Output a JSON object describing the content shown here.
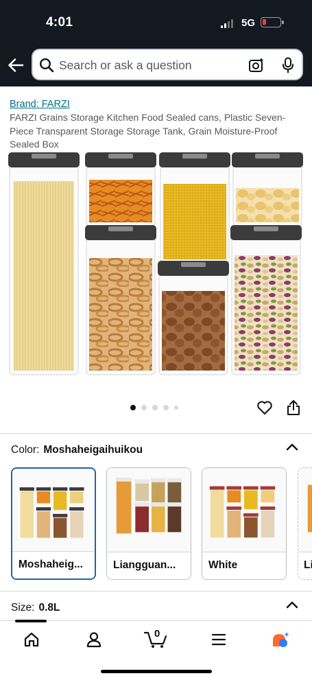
{
  "status": {
    "time": "4:01",
    "network": "5G"
  },
  "search": {
    "placeholder": "Search or ask a question"
  },
  "product": {
    "brand": "Brand: FARZI",
    "title": "FARZI Grains Storage Kitchen Food Sealed cans, Plastic Seven-Piece Transparent Storage Storage Tank, Grain Moisture-Proof Sealed Box",
    "image_count": 5,
    "image_index": 1
  },
  "color": {
    "label": "Color:",
    "selected": "Moshaheigaihuikou",
    "options": [
      {
        "label": "Moshaheig...",
        "selected": true
      },
      {
        "label": "Liangguan...",
        "selected": false
      },
      {
        "label": "White",
        "selected": false
      },
      {
        "label": "Li",
        "selected": false
      }
    ]
  },
  "size": {
    "label": "Size:",
    "selected": "0.8L"
  },
  "nav": {
    "cart_count": "0",
    "items": [
      "home-icon",
      "account-icon",
      "cart-icon",
      "menu-icon",
      "rufus-ai-icon"
    ]
  },
  "colors": {
    "header_bg": "#131921",
    "link": "#007185",
    "selected_border": "#2162a1",
    "ai_orange": "#ff6a2b",
    "ai_blue": "#2d7ff9"
  }
}
